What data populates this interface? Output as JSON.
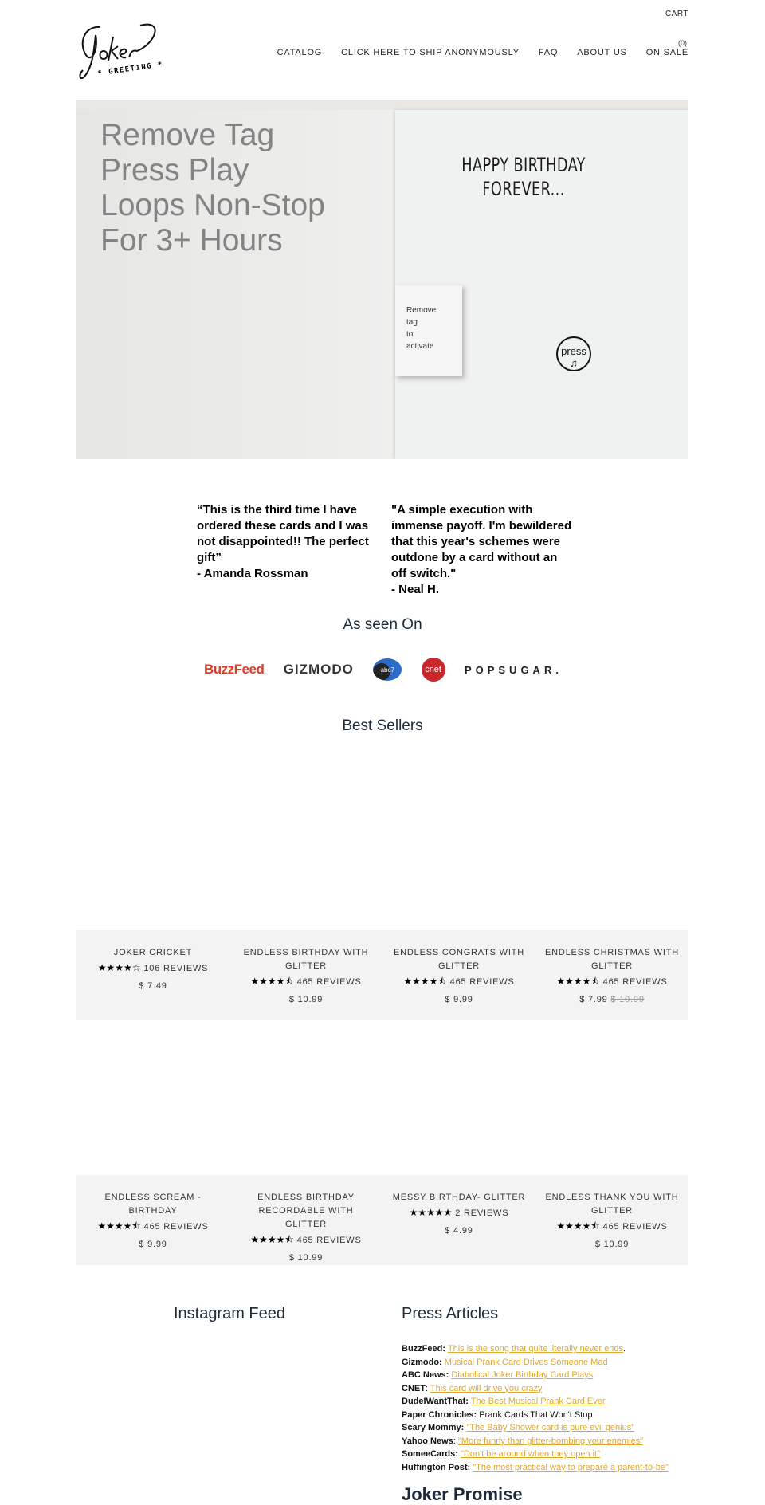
{
  "header": {
    "logo_text": "Joker GREETING",
    "cart_label": "CART",
    "cart_count": "(0)",
    "nav": [
      "CATALOG",
      "CLICK HERE TO SHIP ANONYMOUSLY",
      "FAQ",
      "ABOUT US",
      "ON SALE"
    ]
  },
  "hero": {
    "lines": [
      "Remove Tag",
      "Press Play",
      "Loops Non-Stop",
      "For 3+ Hours"
    ],
    "card_title": [
      "HAPPY BIRTHDAY",
      "FOREVER..."
    ],
    "tag_lines": [
      "Remove",
      "tag",
      "to",
      "activate"
    ],
    "press_button": "press"
  },
  "testimonials": [
    {
      "quote": "“This is the third time I have ordered these cards and I was not disappointed!! The perfect gift”",
      "author": "- Amanda Rossman"
    },
    {
      "quote": "\"A simple execution with immense payoff. I'm bewildered that this year's schemes were outdone by a card without an off switch.\"",
      "author": "- Neal H."
    }
  ],
  "as_seen_on": {
    "title": "As seen On",
    "logos": [
      "BuzzFeed",
      "GIZMODO",
      "abc7",
      "cnet",
      "POPSUGAR."
    ]
  },
  "best_sellers": {
    "title": "Best Sellers",
    "products": [
      {
        "name": "JOKER CRICKET",
        "rating": 4,
        "stars": "★★★★☆",
        "reviews": "106 REVIEWS",
        "price": "$ 7.49"
      },
      {
        "name": "ENDLESS BIRTHDAY WITH GLITTER",
        "rating": 4.5,
        "stars": "★★★★⯪",
        "reviews": "465 REVIEWS",
        "price": "$ 10.99"
      },
      {
        "name": "ENDLESS CONGRATS WITH GLITTER",
        "rating": 4.5,
        "stars": "★★★★⯪",
        "reviews": "465 REVIEWS",
        "price": "$ 9.99"
      },
      {
        "name": "ENDLESS CHRISTMAS WITH GLITTER",
        "rating": 4.5,
        "stars": "★★★★⯪",
        "reviews": "465 REVIEWS",
        "price": "$ 7.99",
        "old_price": "$ 10.99"
      },
      {
        "name": "ENDLESS SCREAM - BIRTHDAY",
        "rating": 4.5,
        "stars": "★★★★⯪",
        "reviews": "465 REVIEWS",
        "price": "$ 9.99"
      },
      {
        "name": "ENDLESS BIRTHDAY RECORDABLE WITH GLITTER",
        "rating": 4.5,
        "stars": "★★★★⯪",
        "reviews": "465 REVIEWS",
        "price": "$ 10.99"
      },
      {
        "name": "MESSY BIRTHDAY- GLITTER",
        "rating": 5,
        "stars": "★★★★★",
        "reviews": "2 REVIEWS",
        "price": "$ 4.99"
      },
      {
        "name": "ENDLESS THANK YOU WITH GLITTER",
        "rating": 4.5,
        "stars": "★★★★⯪",
        "reviews": "465 REVIEWS",
        "price": "$ 10.99"
      }
    ]
  },
  "instagram": {
    "title": "Instagram Feed"
  },
  "press": {
    "title": "Press Articles",
    "link_color": "#e0a92e",
    "items": [
      {
        "source": "BuzzFeed:",
        "link": "This is the song that quite literally never ends",
        "after": "."
      },
      {
        "source": "Gizmodo:",
        "link": "Musical Prank Card Drives Someone Mad"
      },
      {
        "source": "ABC News:",
        "link": "Diabolical Joker Birthday Card Plays"
      },
      {
        "source": "CNET",
        "after_source": ":",
        "link": "This card will drive you crazy"
      },
      {
        "source": "DudeIWantThat:",
        "link": "The Best Musical Prank Card Ever"
      },
      {
        "source": "Paper Chronicles:",
        "text": "Prank Cards That Won't Stop"
      },
      {
        "source": "Scary Mommy:",
        "link": "\"The Baby Shower card is pure evil genius\""
      },
      {
        "source": "Yahoo News",
        "after_source": ":",
        "link": "\"More funny than glitter-bombing your enemies\""
      },
      {
        "source": "SomeeCards:",
        "link": "\"Don't be around when they open it\""
      },
      {
        "source": "Huffington Post:",
        "link": "\"The most practical way to prepare a parent-to-be\""
      }
    ]
  },
  "promise": {
    "title": "Joker Promise"
  }
}
